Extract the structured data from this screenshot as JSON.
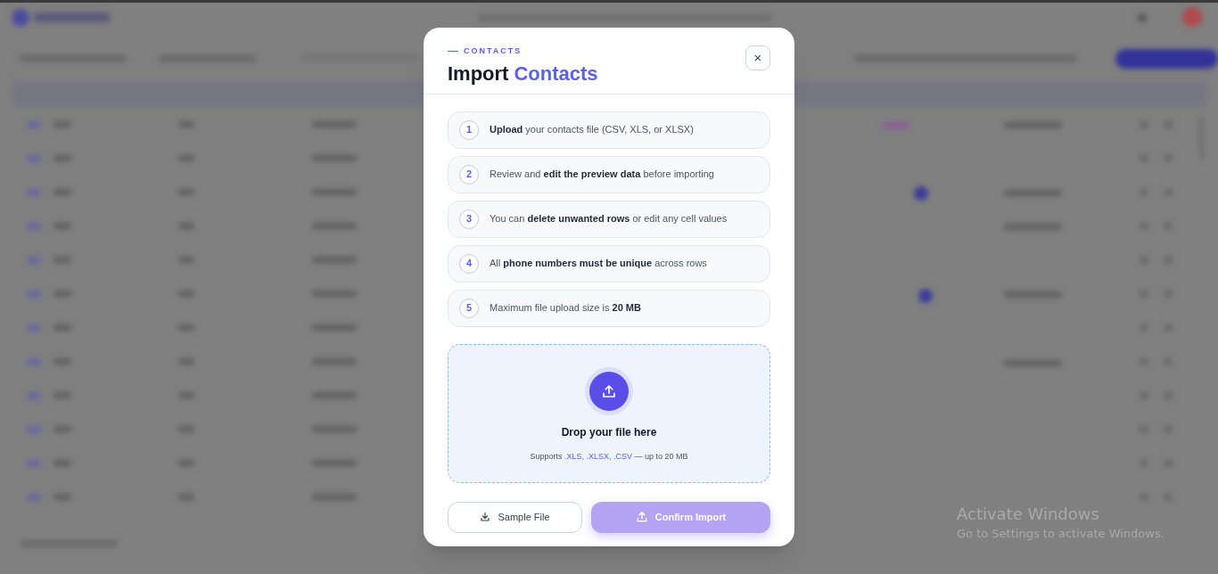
{
  "modal": {
    "eyebrow": "CONTACTS",
    "title_plain": "Import",
    "title_accent": "Contacts",
    "close_label": "×",
    "steps": [
      {
        "number": "1",
        "text": "**Upload** your contacts file (CSV, XLS, or XLSX)"
      },
      {
        "number": "2",
        "text": "Review and **edit the preview data** before importing"
      },
      {
        "number": "3",
        "text": "You can **delete unwanted rows** or edit any cell values"
      },
      {
        "number": "4",
        "text": "All **phone numbers must be unique** across rows"
      },
      {
        "number": "5",
        "text": "Maximum file upload size is **20 MB**"
      }
    ],
    "dropzone": {
      "title": "Drop your file here",
      "hint_prefix": "Supports",
      "formats": ".XLS, .XLSX, .CSV",
      "hint_suffix": "— up to 20 MB"
    },
    "buttons": [
      {
        "label": "Sample File",
        "kind": "download",
        "disabled": false
      },
      {
        "label": "Confirm Import",
        "kind": "confirm",
        "disabled": true
      }
    ]
  },
  "os_notice": {
    "title": "Activate Windows",
    "text": "Go to Settings to activate Windows."
  }
}
